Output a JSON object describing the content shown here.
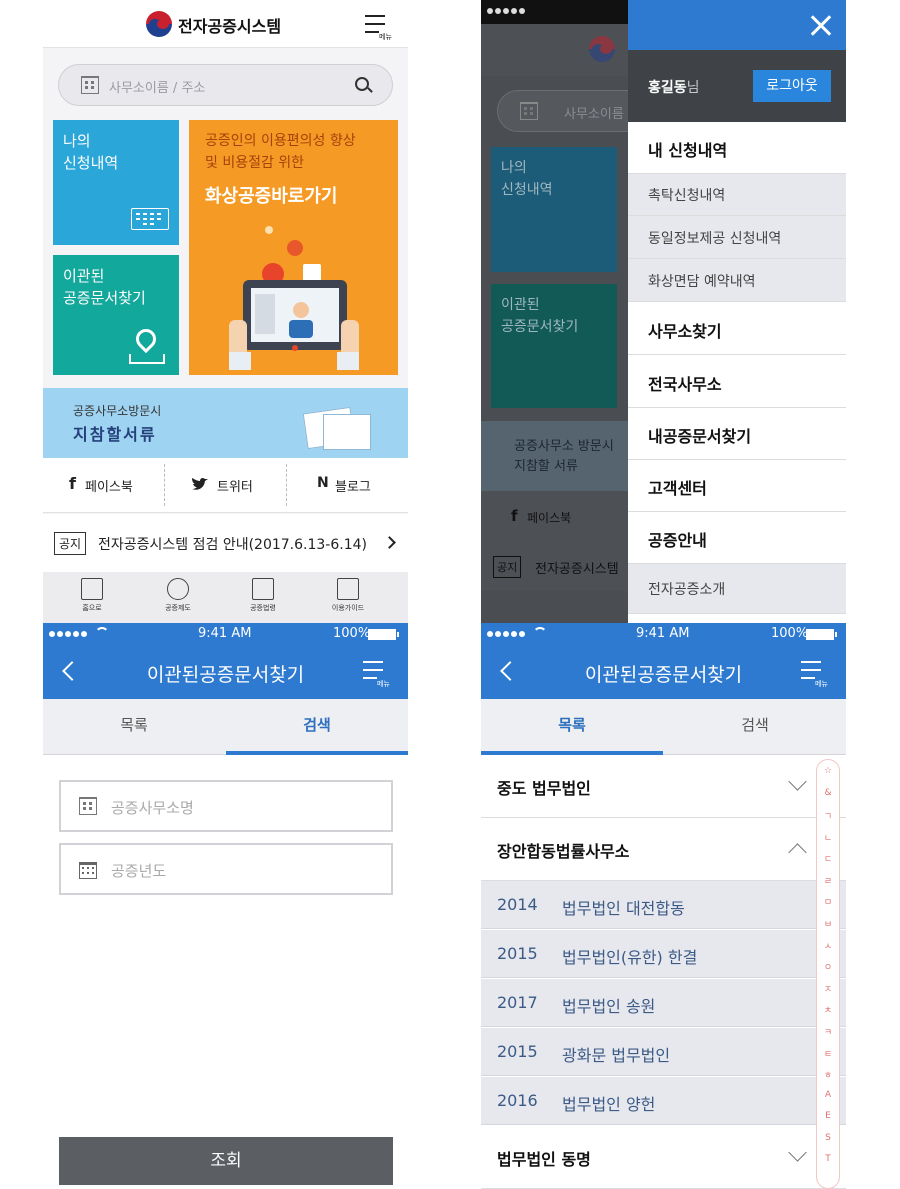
{
  "home": {
    "app_title": "전자공증시스템",
    "menu_label": "메뉴",
    "search_placeholder": "사무소이름 / 주소",
    "tile_my_requests": "나의\n신청내역",
    "tile_transferred_docs": "이관된\n공증문서찾기",
    "promo_line": "공증인의 이용편의성 향상\n및 비용절감 위한",
    "promo_cta": "화상공증바로가기",
    "visit_sub": "공증사무소방문시",
    "visit_title": "지참할서류",
    "social": {
      "facebook": "페이스북",
      "twitter": "트위터",
      "blog": "블로그"
    },
    "notice_badge": "공지",
    "notice_text": "전자공증시스템 점검 안내(2017.6.13-6.14)",
    "bottom_nav": [
      "홈으로",
      "공증제도",
      "공증법령",
      "이용가이드"
    ]
  },
  "drawer": {
    "user_name": "홍길동",
    "user_suffix": "님",
    "logout_label": "로그아웃",
    "items": [
      {
        "label": "내 신청내역",
        "bold": true
      },
      {
        "label": "촉탁신청내역",
        "bold": false
      },
      {
        "label": "동일정보제공 신청내역",
        "bold": false
      },
      {
        "label": "화상면담 예약내역",
        "bold": false
      },
      {
        "label": "사무소찾기",
        "bold": true
      },
      {
        "label": "전국사무소",
        "bold": true
      },
      {
        "label": "내공증문서찾기",
        "bold": true
      },
      {
        "label": "고객센터",
        "bold": true
      },
      {
        "label": "공증안내",
        "bold": true
      },
      {
        "label": "전자공증소개",
        "bold": false
      }
    ],
    "bg_search_placeholder": "사무소이름 / 주소",
    "bg_tile_1": "나의\n신청내역",
    "bg_tile_2": "이관된\n공증문서찾기",
    "bg_visit": "공증사무소 방문시\n지참할 서류",
    "bg_facebook": "페이스북",
    "bg_badge": "공지",
    "bg_notice": "전자공증시스템"
  },
  "status_bar": {
    "time": "9:41 AM",
    "battery": "100%"
  },
  "search_screen": {
    "title": "이관된공증문서찾기",
    "menu_label": "메뉴",
    "tabs": [
      "목록",
      "검색"
    ],
    "active_tab": 1,
    "office_placeholder": "공증사무소명",
    "year_placeholder": "공증년도",
    "submit_label": "조회"
  },
  "list_screen": {
    "title": "이관된공증문서찾기",
    "menu_label": "메뉴",
    "tabs": [
      "목록",
      "검색"
    ],
    "active_tab": 0,
    "groups": [
      {
        "name": "중도 법무법인",
        "expanded": false
      },
      {
        "name": "장안합동법률사무소",
        "expanded": true
      },
      {
        "name": "법무법인 동명",
        "expanded": false
      }
    ],
    "expanded_rows": [
      {
        "year": "2014",
        "name": "법무법인 대전합동"
      },
      {
        "year": "2015",
        "name": "법무법인(유한) 한결"
      },
      {
        "year": "2017",
        "name": "법무법인 송원"
      },
      {
        "year": "2015",
        "name": "광화문 법무법인"
      },
      {
        "year": "2016",
        "name": "법무법인 양헌"
      }
    ],
    "index_letters": [
      "☆",
      "&",
      "ㄱ",
      "ㄴ",
      "ㄷ",
      "ㄹ",
      "ㅁ",
      "ㅂ",
      "ㅅ",
      "ㅇ",
      "ㅈ",
      "ㅊ",
      "ㅋ",
      "ㅌ",
      "ㅎ",
      "A",
      "E",
      "S",
      "T"
    ]
  },
  "colors": {
    "primary": "#2e7ad1",
    "tile_blue": "#2aa6d8",
    "tile_teal": "#13a89c",
    "tile_orange": "#f59a25",
    "visit_bg": "#9fd3f2"
  }
}
